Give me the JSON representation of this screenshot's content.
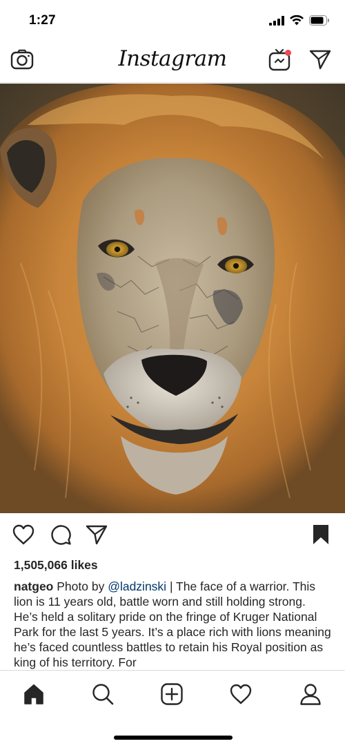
{
  "status_bar": {
    "time": "1:27",
    "icons": [
      "signal-icon",
      "wifi-icon",
      "battery-icon"
    ]
  },
  "header": {
    "logo_text": "Instagram",
    "left_icon": "camera-icon",
    "right_icons": [
      "igtv-icon",
      "direct-message-icon"
    ],
    "notification_dot_color": "#ed4956"
  },
  "post": {
    "image_subject": "lion-face-photo",
    "actions": [
      "heart-icon",
      "comment-icon",
      "share-icon",
      "bookmark-icon"
    ],
    "likes": "1,505,066 likes",
    "caption": {
      "username": "natgeo",
      "before_mention": " Photo by ",
      "mention": "@ladzinski",
      "text": " | The face of a warrior. This lion is 11 years old, battle worn and still holding strong. He’s held a solitary pride on the fringe of Kruger National Park for the last 5 years. It’s a place rich with lions meaning he’s faced countless battles to retain his Royal position as king of his territory. For"
    },
    "mention_color": "#00376b"
  },
  "bottom_nav": {
    "items": [
      "home-icon",
      "search-icon",
      "new-post-icon",
      "activity-heart-icon",
      "profile-icon"
    ],
    "active": "home-icon"
  }
}
